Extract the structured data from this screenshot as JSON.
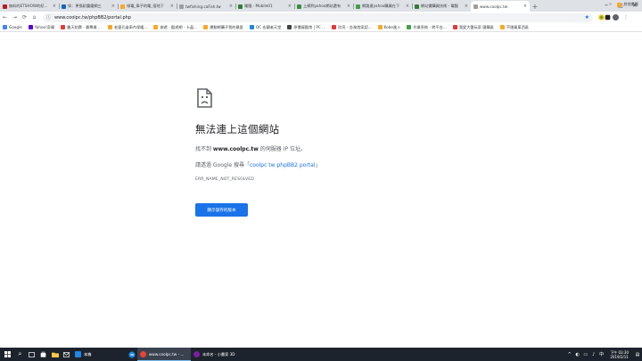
{
  "tabs": [
    {
      "title": "無料的ETSHOW的紀念館",
      "color": "#b71c1c"
    },
    {
      "title": "如：更換耐震鐵網三",
      "color": "#1565c0"
    },
    {
      "title": "綠電_車子的電_宿地下",
      "color": "#f9a825"
    },
    {
      "title": "twfishing.caFish.tw",
      "color": "#9e9e9e"
    },
    {
      "title": "電腦 - Mobile01",
      "color": "#2e7d32"
    },
    {
      "title": "上網到yahoo網站還有",
      "color": "#388e3c"
    },
    {
      "title": "網路連yahoo購買在下",
      "color": "#43a047"
    },
    {
      "title": "網站價購買技術 - 電腦",
      "color": "#2e7d32"
    },
    {
      "title": "www.coolpc.tw",
      "color": "#9e9e9e",
      "active": true
    }
  ],
  "window_controls": {
    "minimize": "─",
    "maximize": "□",
    "close": "✕"
  },
  "toolbar": {
    "back": "←",
    "forward": "→",
    "reload": "⟳",
    "home": "⌂",
    "info": "ⓘ",
    "url": "www.coolpc.tw/phpBB2/portal.php",
    "star": "★",
    "menu": "⋮"
  },
  "bookmarks": [
    {
      "label": "Google",
      "color": "#4285f4"
    },
    {
      "label": "Yahoo!奇摩",
      "color": "#6001d2"
    },
    {
      "label": "露天拍賣 - 最專業 ...",
      "color": "#e53935"
    },
    {
      "label": "老婆孔雀車內保暖...",
      "color": "#f9a825"
    },
    {
      "label": "旅遊 - 酷遊網 - 卡晶...",
      "color": "#f9a825"
    },
    {
      "label": "運動網購子我的最愛",
      "color": "#f9a825"
    },
    {
      "label": "OC 宏觀者天堂",
      "color": "#1e88e5"
    },
    {
      "label": "原價屋酷幣 | PC ...",
      "color": "#424242"
    },
    {
      "label": "欣亮 - 台灣首家認...",
      "color": "#e53935"
    },
    {
      "label": "Kobe進入",
      "color": "#f9a825"
    },
    {
      "label": "作業系統 - 跨平台...",
      "color": "#43a047"
    },
    {
      "label": "我愛大盤玩家 團購區",
      "color": "#e53935"
    },
    {
      "label": "不錯買東西區",
      "color": "#f9a825"
    }
  ],
  "bookmarks_more": "»",
  "other_bookmarks": "其他書籤",
  "error": {
    "title": "無法連上這個網站",
    "p1_prefix": "找不到 ",
    "host": "www.coolpc.tw",
    "p1_suffix": " 的伺服器 IP 位址。",
    "p2_prefix": "請透過 Google 搜尋「",
    "search_link": "coolpc tw phpBB2 portal",
    "p2_suffix": "」",
    "code": "ERR_NAME_NOT_RESOLVED",
    "button": "顯示儲存的版本"
  },
  "taskbar": {
    "search": "⌕",
    "pinned_label": "本機",
    "tasks": [
      {
        "label": "www.coolpc.tw - ...",
        "color": "#ea4335",
        "active": true
      },
      {
        "label": "未命名 - 小畫家 3D",
        "color": "#7b1fa2"
      }
    ],
    "tray_icons": [
      "^",
      "◐",
      "▭",
      "♪",
      "中"
    ],
    "time": "下午 03:30",
    "date": "2019/2/11",
    "notifications": "▤"
  }
}
